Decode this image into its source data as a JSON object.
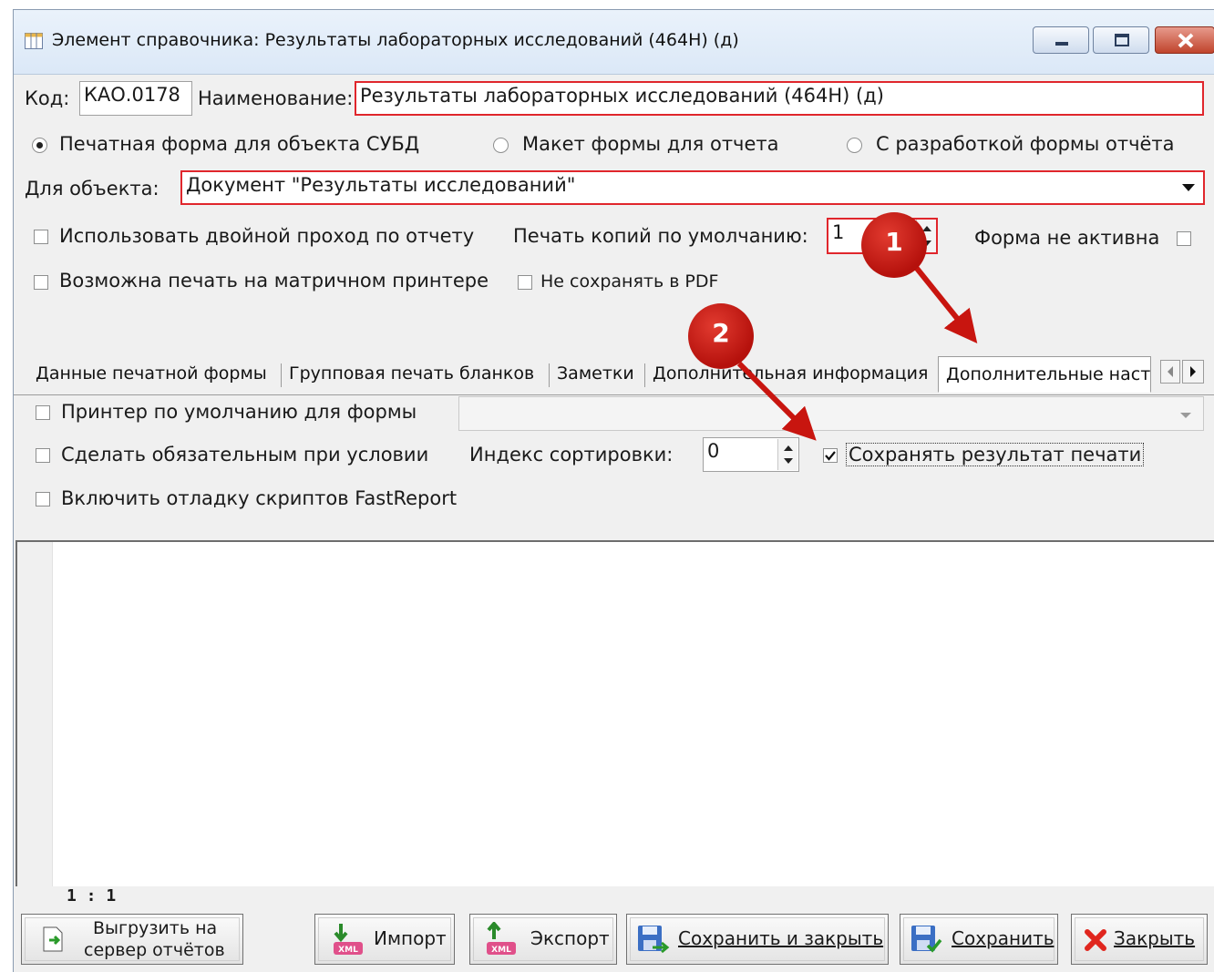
{
  "window": {
    "title": "Элемент справочника: Результаты лабораторных исследований (464Н) (д)"
  },
  "form": {
    "code_label": "Код:",
    "code_value": "КАО.0178",
    "name_label": "Наименование:",
    "name_value": "Результаты лабораторных исследований (464Н) (д)",
    "radio_options": [
      {
        "label": "Печатная форма для объекта СУБД",
        "selected": true
      },
      {
        "label": "Макет формы для отчета",
        "selected": false
      },
      {
        "label": "С разработкой формы отчёта",
        "selected": false
      }
    ],
    "object_label": "Для объекта:",
    "object_value": "Документ \"Результаты исследований\"",
    "double_pass_label": "Использовать двойной проход по отчету",
    "copies_label": "Печать копий по умолчанию:",
    "copies_value": "1",
    "inactive_label": "Форма не активна",
    "matrix_label": "Возможна печать на матричном принтере",
    "no_pdf_label": "Не сохранять в PDF"
  },
  "tabs": [
    {
      "label": "Данные печатной формы"
    },
    {
      "label": "Групповая печать бланков"
    },
    {
      "label": "Заметки"
    },
    {
      "label": "Дополнительная информация"
    },
    {
      "label": "Дополнительные наст"
    }
  ],
  "settings": {
    "default_printer_label": "Принтер по умолчанию для формы",
    "mandatory_label": "Сделать обязательным при условии",
    "sort_index_label": "Индекс сортировки:",
    "sort_index_value": "0",
    "save_result_label": "Сохранять результат печати",
    "save_result_checked": true,
    "debug_label": "Включить отладку скриптов FastReport"
  },
  "editor": {
    "cursor_pos": "1 : 1"
  },
  "buttons": {
    "upload_line1": "Выгрузить на",
    "upload_line2": "сервер отчётов",
    "import": "Импорт",
    "export": "Экспорт",
    "save_close": "Сохранить и закрыть",
    "save": "Сохранить",
    "close": "Закрыть"
  },
  "annotations": {
    "badge1": "1",
    "badge2": "2",
    "color": "#c8150f"
  }
}
